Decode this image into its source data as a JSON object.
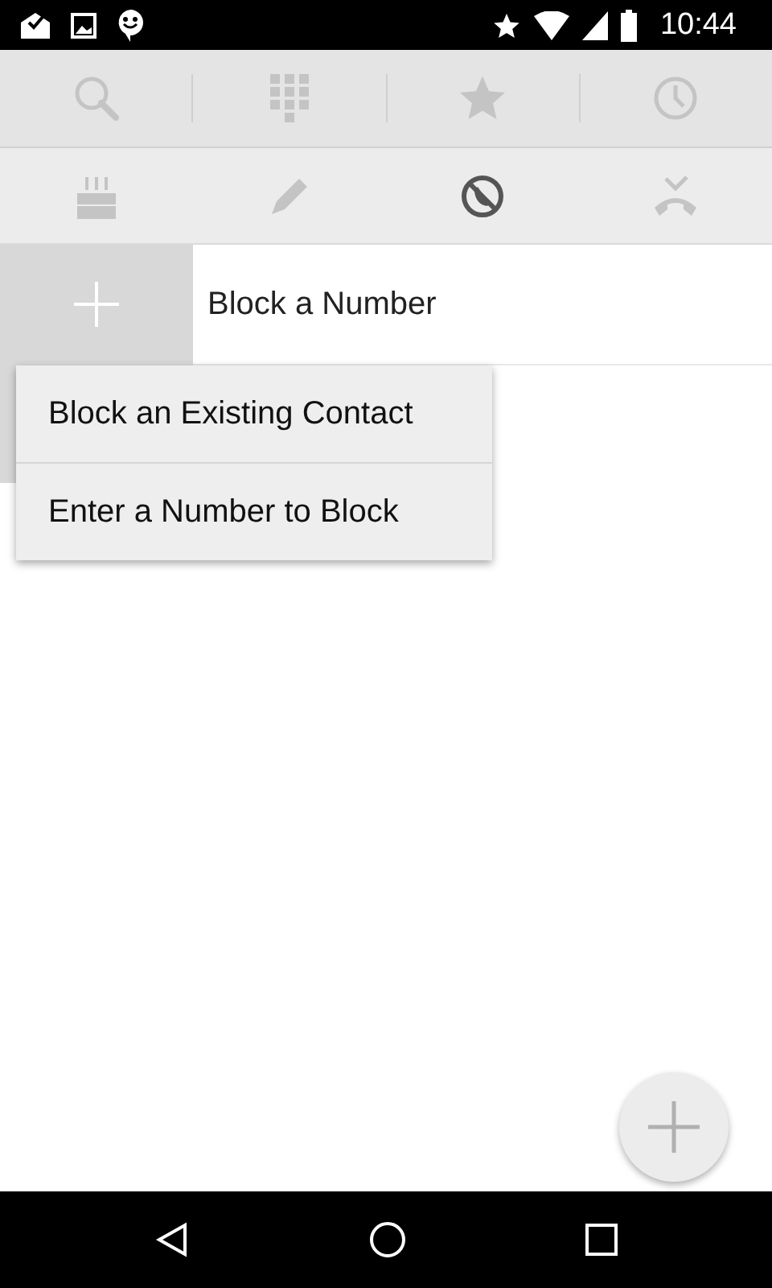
{
  "status_bar": {
    "time": "10:44"
  },
  "main_tabs": [
    {
      "kind": "search"
    },
    {
      "kind": "dialpad"
    },
    {
      "kind": "star"
    },
    {
      "kind": "clock"
    }
  ],
  "sub_tabs": [
    {
      "kind": "cake",
      "selected": false
    },
    {
      "kind": "pencil",
      "selected": false
    },
    {
      "kind": "block",
      "selected": true
    },
    {
      "kind": "missed",
      "selected": false
    }
  ],
  "list": {
    "add_label": "Block a Number"
  },
  "menu": {
    "items": [
      {
        "label": "Block an Existing Contact"
      },
      {
        "label": "Enter a Number to Block"
      }
    ]
  }
}
